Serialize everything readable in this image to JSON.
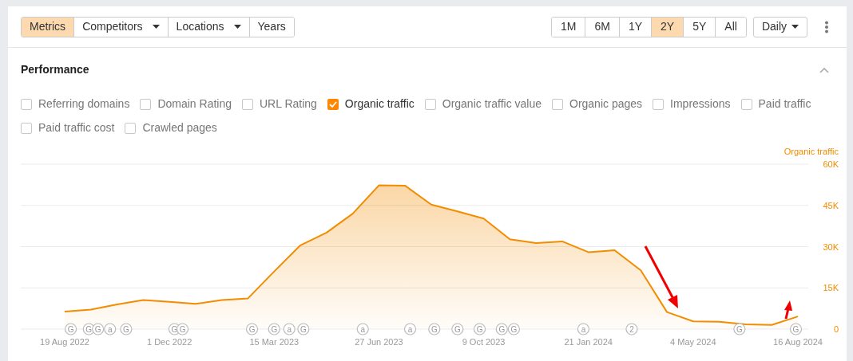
{
  "toolbar": {
    "views": [
      {
        "label": "Metrics",
        "selected": true,
        "dropdown": false
      },
      {
        "label": "Competitors",
        "selected": false,
        "dropdown": true
      },
      {
        "label": "Locations",
        "selected": false,
        "dropdown": true
      },
      {
        "label": "Years",
        "selected": false,
        "dropdown": false
      }
    ],
    "ranges": [
      {
        "label": "1M",
        "selected": false
      },
      {
        "label": "6M",
        "selected": false
      },
      {
        "label": "1Y",
        "selected": false
      },
      {
        "label": "2Y",
        "selected": true
      },
      {
        "label": "5Y",
        "selected": false
      },
      {
        "label": "All",
        "selected": false
      }
    ],
    "interval": {
      "label": "Daily"
    }
  },
  "performance": {
    "title": "Performance",
    "expanded": true,
    "metrics": [
      {
        "label": "Referring domains",
        "checked": false
      },
      {
        "label": "Domain Rating",
        "checked": false
      },
      {
        "label": "URL Rating",
        "checked": false
      },
      {
        "label": "Organic traffic",
        "checked": true
      },
      {
        "label": "Organic traffic value",
        "checked": false
      },
      {
        "label": "Organic pages",
        "checked": false
      },
      {
        "label": "Impressions",
        "checked": false
      },
      {
        "label": "Paid traffic",
        "checked": false
      },
      {
        "label": "Paid traffic cost",
        "checked": false
      },
      {
        "label": "Crawled pages",
        "checked": false
      }
    ],
    "chart_data": {
      "type": "area",
      "grid": true,
      "ylim": [
        0,
        60000
      ],
      "categories": [
        "19 Aug 2022",
        null,
        null,
        null,
        "1 Dec 2022",
        null,
        null,
        null,
        "15 Mar 2023",
        null,
        null,
        null,
        "27 Jun 2023",
        null,
        null,
        null,
        "9 Oct 2023",
        null,
        null,
        null,
        "21 Jan 2024",
        null,
        null,
        null,
        "4 May 2024",
        null,
        null,
        null,
        "16 Aug 2024"
      ],
      "series": [
        {
          "name": "Organic traffic",
          "color": "#f28c00",
          "values": [
            6400,
            7100,
            9000,
            10600,
            9900,
            9200,
            10600,
            11200,
            21000,
            30500,
            35100,
            42000,
            52300,
            52200,
            45300,
            42800,
            40200,
            32700,
            31300,
            31900,
            28000,
            28700,
            21400,
            6200,
            2800,
            2700,
            1700,
            1500,
            4600
          ]
        }
      ],
      "yticks": [
        {
          "value": 0,
          "label": "0"
        },
        {
          "value": 15000,
          "label": "15K"
        },
        {
          "value": 30000,
          "label": "30K"
        },
        {
          "value": 45000,
          "label": "45K"
        },
        {
          "value": 60000,
          "label": "60K"
        }
      ]
    },
    "events": [
      {
        "text": "G"
      },
      {
        "text": "G"
      },
      {
        "text": "G"
      },
      {
        "text": "a"
      },
      {
        "text": "G"
      },
      {
        "text": "G"
      },
      {
        "text": "G"
      },
      {
        "text": "G"
      },
      {
        "text": "G"
      },
      {
        "text": "a"
      },
      {
        "text": "G"
      },
      {
        "text": "a"
      },
      {
        "text": "a"
      },
      {
        "text": "G"
      },
      {
        "text": "G"
      },
      {
        "text": "G"
      },
      {
        "text": "G"
      },
      {
        "text": "G"
      },
      {
        "text": "a"
      },
      {
        "text": "2"
      },
      {
        "text": "G"
      },
      {
        "text": "G"
      }
    ]
  }
}
